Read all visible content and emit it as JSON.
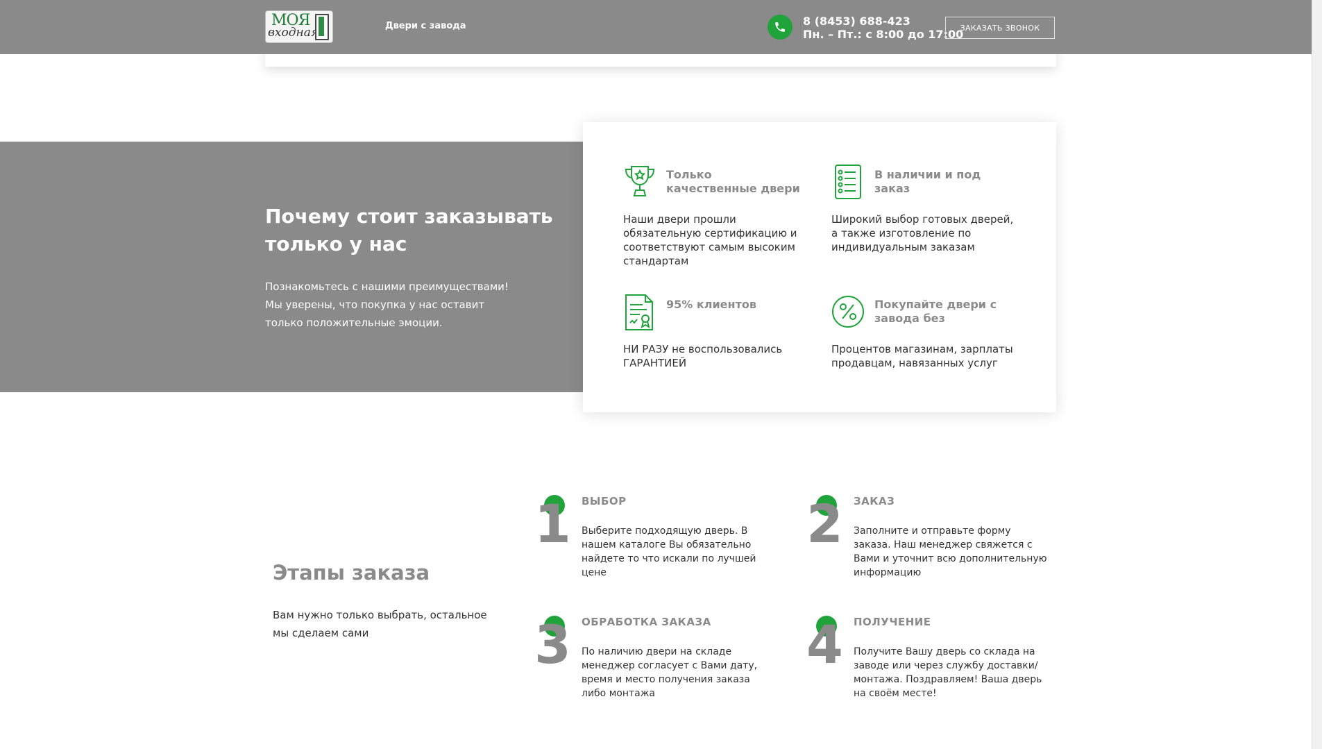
{
  "header": {
    "logo_line1": "МОЯ",
    "logo_line2": "входная",
    "nav_link": "Двери с завода",
    "phone": "8 (8453) 688-423",
    "hours": "Пн. – Пт.: с 8:00 до 17:00",
    "call_button": "ЗАКАЗАТЬ ЗВОНОК"
  },
  "why": {
    "title": "Почему стоит заказывать только у нас",
    "text": "Познакомьтесь с нашими преимуществами! Мы уверены, что покупка у нас оставит только положительные эмоции.",
    "features": [
      {
        "icon": "trophy-icon",
        "title": "Только качественные двери",
        "text": "Наши двери прошли обязательную сертификацию и соответствуют самым высоким стандартам"
      },
      {
        "icon": "checklist-icon",
        "title": "В наличии и под заказ",
        "text": "Широкий выбор готовых дверей, а также изготовление по индивидуальным заказам"
      },
      {
        "icon": "certificate-icon",
        "title": "95% клиентов",
        "text": "НИ РАЗУ не воспользовались ГАРАНТИЕЙ"
      },
      {
        "icon": "percent-icon",
        "title": "Покупайте двери с завода без",
        "text": "Процентов магазинам, зарплаты продавцам, навязанных услуг"
      }
    ]
  },
  "steps": {
    "title": "Этапы заказа",
    "subtitle": "Вам нужно только выбрать, остальное мы сделаем сами",
    "items": [
      {
        "num": "1",
        "title": "ВЫБОР",
        "text": "Выберите подходящую дверь. В нашем каталоге Вы обязательно найдете то что искали по лучшей цене"
      },
      {
        "num": "2",
        "title": "ЗАКАЗ",
        "text": "Заполните и отправьте форму заказа. Наш менеджер свяжется с Вами и уточнит всю дополнительную информацию"
      },
      {
        "num": "3",
        "title": "ОБРАБОТКА ЗАКАЗА",
        "text": "По наличию двери на складе менеджер согласует с Вами дату, время и место получения заказа либо монтажа"
      },
      {
        "num": "4",
        "title": "ПОЛУЧЕНИЕ",
        "text": "Получите Вашу дверь со склада на заводе или через службу доставки/монтажа. Поздравляем! Ваша дверь на своём месте!"
      }
    ]
  },
  "colors": {
    "accent": "#1fa33a",
    "gray": "#8a8a8a"
  }
}
